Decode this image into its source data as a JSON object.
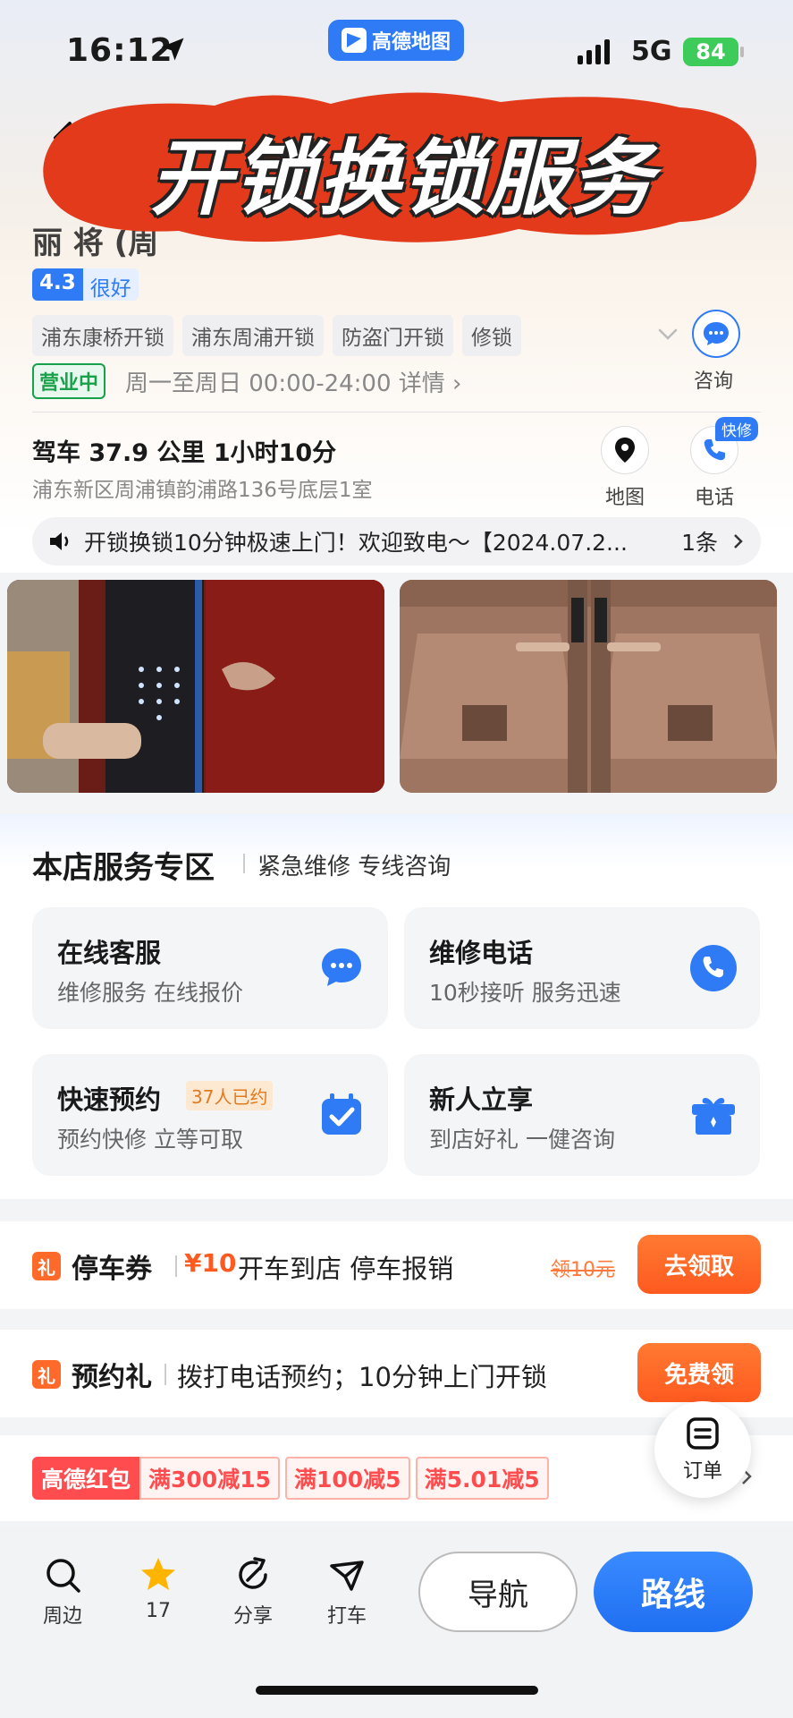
{
  "status_bar": {
    "time": "16:12",
    "app_name": "高德地图",
    "network": "5G",
    "battery": "84"
  },
  "banner": {
    "text": "开锁换锁服务"
  },
  "header": {
    "title_partial": "丽    将      (周"
  },
  "rating": {
    "score": "4.3",
    "label": "很好"
  },
  "tags": [
    "浦东康桥开锁",
    "浦东周浦开锁",
    "防盗门开锁",
    "修锁"
  ],
  "consult": {
    "label": "咨询"
  },
  "hours": {
    "status": "营业中",
    "text": "周一至周日 00:00-24:00  详情"
  },
  "location": {
    "drive": "驾车 37.9 公里 1小时10分",
    "address": "浦东新区周浦镇韵浦路136号底层1室",
    "map_label": "地图",
    "phone_label": "电话",
    "phone_badge": "快修"
  },
  "notice": {
    "text": "开锁换锁10分钟极速上门！欢迎致电～【2024.07.2...",
    "count": "1条"
  },
  "service": {
    "title": "本店服务专区",
    "subtitle": "紧急维修 专线咨询",
    "cards": [
      {
        "title": "在线客服",
        "subtitle": "维修服务 在线报价",
        "icon": "chat-icon"
      },
      {
        "title": "维修电话",
        "subtitle": "10秒接听 服务迅速",
        "icon": "phone-icon"
      },
      {
        "title": "快速预约",
        "badge": "37人已约",
        "subtitle": "预约快修 立等可取",
        "icon": "calendar-check-icon"
      },
      {
        "title": "新人立享",
        "subtitle": "到店好礼 一健咨询",
        "icon": "gift-icon"
      }
    ]
  },
  "promos": [
    {
      "badge": "礼",
      "name": "停车券",
      "price": "¥10",
      "desc": "开车到店 停车报销",
      "strike": "领10元",
      "button": "去领取"
    },
    {
      "badge": "礼",
      "name": "预约礼",
      "desc": "拨打电话预约；10分钟上门开锁",
      "button": "免费领"
    }
  ],
  "coupons": {
    "brand": "高德红包",
    "items": [
      "满300减15",
      "满100减5",
      "满5.01减5"
    ]
  },
  "order_fab": {
    "label": "订单"
  },
  "bottom_bar": {
    "tabs": [
      {
        "label": "周边",
        "icon": "search-icon"
      },
      {
        "label": "17",
        "icon": "star-icon"
      },
      {
        "label": "分享",
        "icon": "share-icon"
      },
      {
        "label": "打车",
        "icon": "taxi-icon"
      }
    ],
    "nav_label": "导航",
    "route_label": "路线"
  },
  "colors": {
    "brand_blue": "#2f7bf6",
    "orange": "#ff5a1f",
    "green": "#18a04a",
    "banner_red": "#e23a1a"
  }
}
